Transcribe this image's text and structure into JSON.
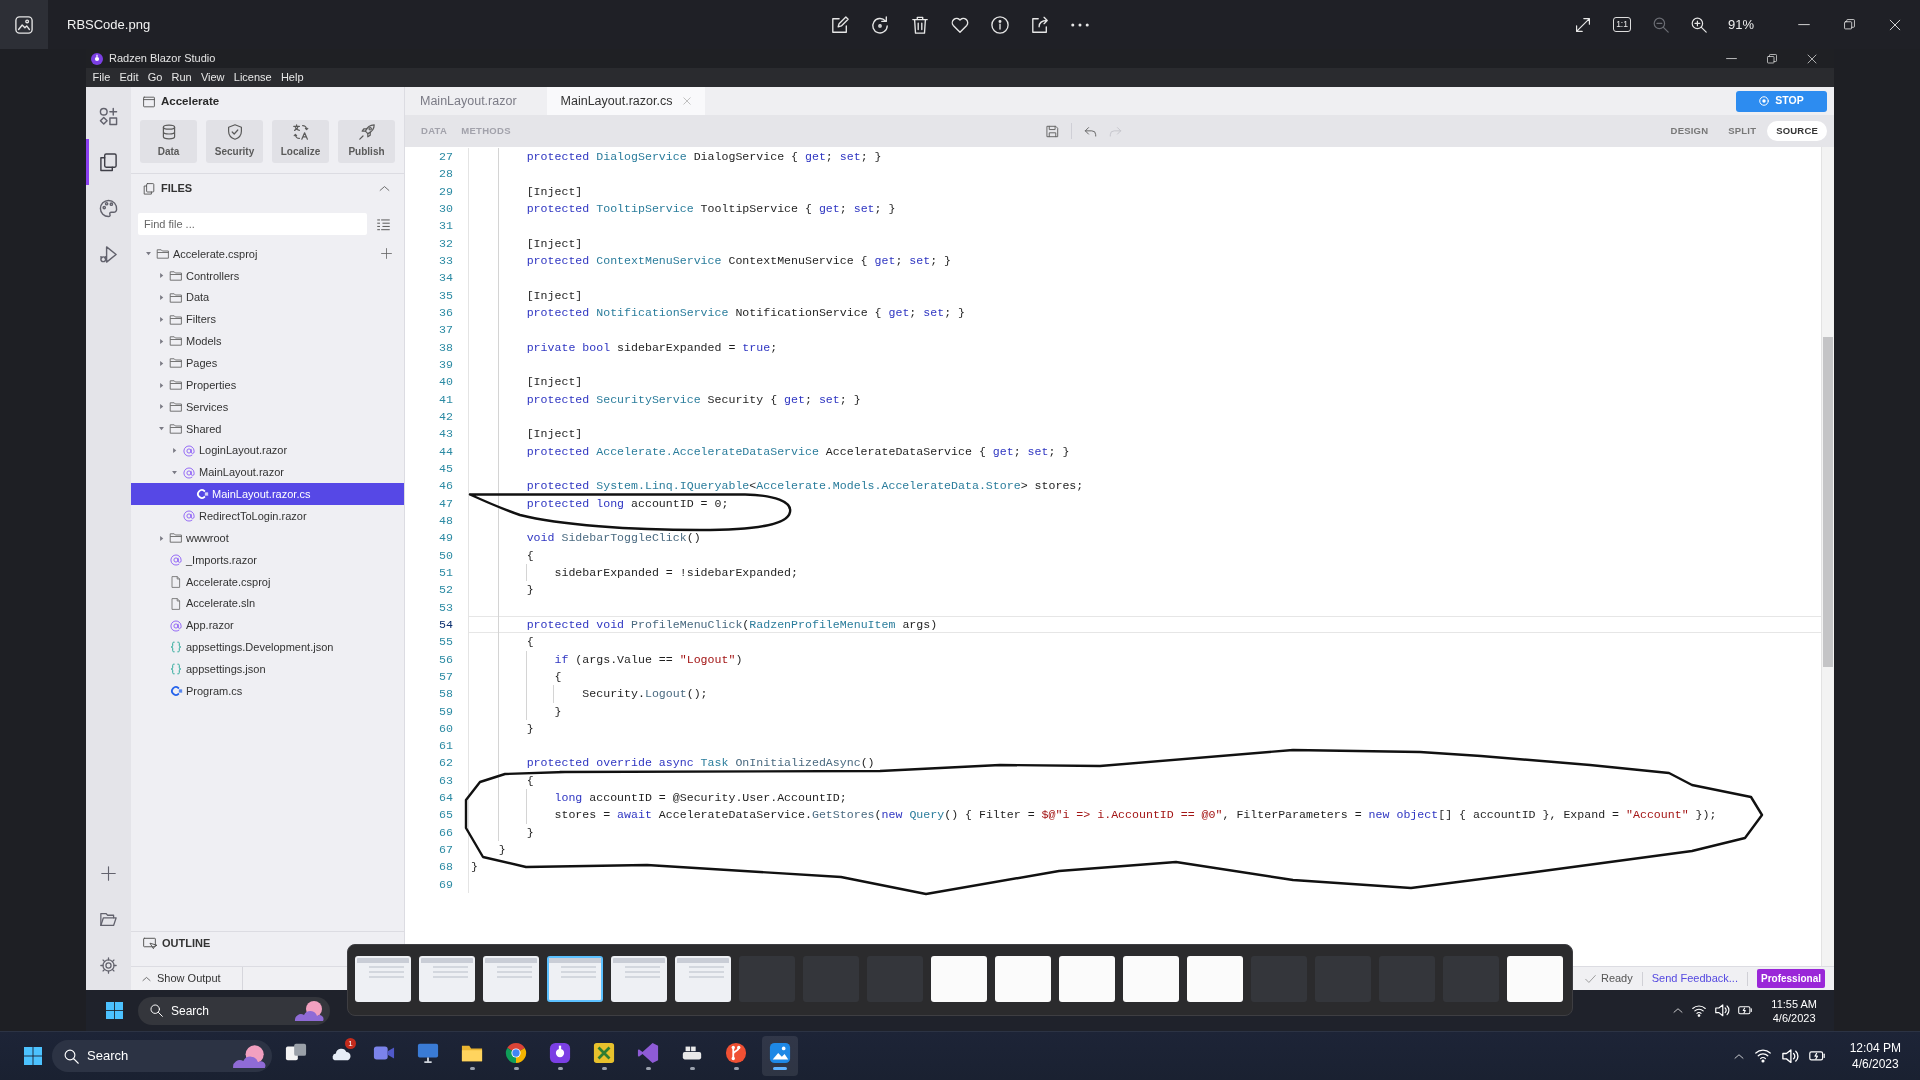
{
  "viewer": {
    "file_name": "RBSCode.png",
    "actual_size_label": "1:1",
    "can_zoom_out": false,
    "zoom_label": "91%"
  },
  "app": {
    "title": "Radzen Blazor Studio",
    "menu": [
      "File",
      "Edit",
      "Go",
      "Run",
      "View",
      "License",
      "Help"
    ]
  },
  "activity_bar": [
    {
      "kind": "components",
      "selected": false
    },
    {
      "kind": "files",
      "selected": true
    },
    {
      "kind": "themes",
      "selected": false
    },
    {
      "kind": "run",
      "selected": false
    }
  ],
  "project": {
    "name": "Accelerate",
    "tools": [
      {
        "kind": "data",
        "label": "Data"
      },
      {
        "kind": "security",
        "label": "Security"
      },
      {
        "kind": "localize",
        "label": "Localize"
      },
      {
        "kind": "publish",
        "label": "Publish"
      }
    ]
  },
  "files": {
    "title": "FILES",
    "search": {
      "placeholder": "Find file ..."
    },
    "tree": [
      {
        "label": "Accelerate.csproj",
        "kind": "folder",
        "expanded": true,
        "selected": false,
        "children": [
          {
            "label": "Controllers",
            "kind": "folder",
            "expanded": false,
            "selected": false
          },
          {
            "label": "Data",
            "kind": "folder",
            "expanded": false,
            "selected": false
          },
          {
            "label": "Filters",
            "kind": "folder",
            "expanded": false,
            "selected": false
          },
          {
            "label": "Models",
            "kind": "folder",
            "expanded": false,
            "selected": false
          },
          {
            "label": "Pages",
            "kind": "folder",
            "expanded": false,
            "selected": false
          },
          {
            "label": "Properties",
            "kind": "folder",
            "expanded": false,
            "selected": false
          },
          {
            "label": "Services",
            "kind": "folder",
            "expanded": false,
            "selected": false
          },
          {
            "label": "Shared",
            "kind": "folder",
            "expanded": true,
            "selected": false,
            "children": [
              {
                "label": "LoginLayout.razor",
                "kind": "razor",
                "expanded": false,
                "selected": false
              },
              {
                "label": "MainLayout.razor",
                "kind": "razor",
                "expanded": true,
                "selected": false,
                "children": [
                  {
                    "label": "MainLayout.razor.cs",
                    "kind": "csharp",
                    "selected": true
                  }
                ]
              },
              {
                "label": "RedirectToLogin.razor",
                "kind": "razor",
                "selected": false
              }
            ]
          },
          {
            "label": "wwwroot",
            "kind": "folder",
            "expanded": false,
            "selected": false
          },
          {
            "label": "_Imports.razor",
            "kind": "razor",
            "selected": false
          },
          {
            "label": "Accelerate.csproj",
            "kind": "file",
            "selected": false
          },
          {
            "label": "Accelerate.sln",
            "kind": "file",
            "selected": false
          },
          {
            "label": "App.razor",
            "kind": "razor",
            "selected": false
          },
          {
            "label": "appsettings.Development.json",
            "kind": "json",
            "selected": false
          },
          {
            "label": "appsettings.json",
            "kind": "json",
            "selected": false
          },
          {
            "label": "Program.cs",
            "kind": "csharp",
            "selected": false
          }
        ]
      }
    ]
  },
  "outline": {
    "title": "OUTLINE"
  },
  "tabs": [
    {
      "label": "MainLayout.razor",
      "selected": false
    },
    {
      "label": "MainLayout.razor.cs",
      "selected": true
    }
  ],
  "run_button": "STOP",
  "designer_tabs": [
    "DATA",
    "METHODS"
  ],
  "history": {
    "can_undo": true,
    "can_redo": false
  },
  "view_modes": [
    {
      "label": "DESIGN",
      "selected": false
    },
    {
      "label": "SPLIT",
      "selected": false
    },
    {
      "label": "SOURCE",
      "selected": true
    }
  ],
  "editor": {
    "lines": [
      {
        "number": "27",
        "current": false,
        "tokens": [
          {
            "kind": "keyword",
            "text": "protected "
          },
          {
            "kind": "type",
            "text": "DialogService"
          },
          {
            "kind": "text",
            "text": " DialogService { "
          },
          {
            "kind": "keyword",
            "text": "get"
          },
          {
            "kind": "text",
            "text": "; "
          },
          {
            "kind": "keyword",
            "text": "set"
          },
          {
            "kind": "text",
            "text": "; }"
          }
        ]
      },
      {
        "number": "28",
        "current": false
      },
      {
        "number": "29",
        "current": false,
        "tokens": [
          {
            "kind": "text",
            "text": "[Inject]"
          }
        ]
      },
      {
        "number": "30",
        "current": false,
        "tokens": [
          {
            "kind": "keyword",
            "text": "protected "
          },
          {
            "kind": "type",
            "text": "TooltipService"
          },
          {
            "kind": "text",
            "text": " TooltipService { "
          },
          {
            "kind": "keyword",
            "text": "get"
          },
          {
            "kind": "text",
            "text": "; "
          },
          {
            "kind": "keyword",
            "text": "set"
          },
          {
            "kind": "text",
            "text": "; }"
          }
        ]
      },
      {
        "number": "31",
        "current": false
      },
      {
        "number": "32",
        "current": false,
        "tokens": [
          {
            "kind": "text",
            "text": "[Inject]"
          }
        ]
      },
      {
        "number": "33",
        "current": false,
        "tokens": [
          {
            "kind": "keyword",
            "text": "protected "
          },
          {
            "kind": "type",
            "text": "ContextMenuService"
          },
          {
            "kind": "text",
            "text": " ContextMenuService { "
          },
          {
            "kind": "keyword",
            "text": "get"
          },
          {
            "kind": "text",
            "text": "; "
          },
          {
            "kind": "keyword",
            "text": "set"
          },
          {
            "kind": "text",
            "text": "; }"
          }
        ]
      },
      {
        "number": "34",
        "current": false
      },
      {
        "number": "35",
        "current": false,
        "tokens": [
          {
            "kind": "text",
            "text": "[Inject]"
          }
        ]
      },
      {
        "number": "36",
        "current": false,
        "tokens": [
          {
            "kind": "keyword",
            "text": "protected "
          },
          {
            "kind": "type",
            "text": "NotificationService"
          },
          {
            "kind": "text",
            "text": " NotificationService { "
          },
          {
            "kind": "keyword",
            "text": "get"
          },
          {
            "kind": "text",
            "text": "; "
          },
          {
            "kind": "keyword",
            "text": "set"
          },
          {
            "kind": "text",
            "text": "; }"
          }
        ]
      },
      {
        "number": "37",
        "current": false
      },
      {
        "number": "38",
        "current": false,
        "tokens": [
          {
            "kind": "keyword",
            "text": "private bool"
          },
          {
            "kind": "text",
            "text": " sidebarExpanded = "
          },
          {
            "kind": "keyword",
            "text": "true"
          },
          {
            "kind": "text",
            "text": ";"
          }
        ]
      },
      {
        "number": "39",
        "current": false
      },
      {
        "number": "40",
        "current": false,
        "tokens": [
          {
            "kind": "text",
            "text": "[Inject]"
          }
        ]
      },
      {
        "number": "41",
        "current": false,
        "tokens": [
          {
            "kind": "keyword",
            "text": "protected "
          },
          {
            "kind": "type",
            "text": "SecurityService"
          },
          {
            "kind": "text",
            "text": " Security { "
          },
          {
            "kind": "keyword",
            "text": "get"
          },
          {
            "kind": "text",
            "text": "; "
          },
          {
            "kind": "keyword",
            "text": "set"
          },
          {
            "kind": "text",
            "text": "; }"
          }
        ]
      },
      {
        "number": "42",
        "current": false
      },
      {
        "number": "43",
        "current": false,
        "tokens": [
          {
            "kind": "text",
            "text": "[Inject]"
          }
        ]
      },
      {
        "number": "44",
        "current": false,
        "tokens": [
          {
            "kind": "keyword",
            "text": "protected "
          },
          {
            "kind": "type",
            "text": "Accelerate.AccelerateDataService"
          },
          {
            "kind": "text",
            "text": " AccelerateDataService { "
          },
          {
            "kind": "keyword",
            "text": "get"
          },
          {
            "kind": "text",
            "text": "; "
          },
          {
            "kind": "keyword",
            "text": "set"
          },
          {
            "kind": "text",
            "text": "; }"
          }
        ]
      },
      {
        "number": "45",
        "current": false
      },
      {
        "number": "46",
        "current": false,
        "tokens": [
          {
            "kind": "keyword",
            "text": "protected "
          },
          {
            "kind": "type",
            "text": "System.Linq.IQueryable"
          },
          {
            "kind": "text",
            "text": "<"
          },
          {
            "kind": "type",
            "text": "Accelerate.Models.AccelerateData.Store"
          },
          {
            "kind": "text",
            "text": "> stores;"
          }
        ]
      },
      {
        "number": "47",
        "current": false,
        "tokens": [
          {
            "kind": "keyword",
            "text": "protected long"
          },
          {
            "kind": "text",
            "text": " accountID = 0;"
          }
        ]
      },
      {
        "number": "48",
        "current": false
      },
      {
        "number": "49",
        "current": false,
        "tokens": [
          {
            "kind": "keyword",
            "text": "void "
          },
          {
            "kind": "method",
            "text": "SidebarToggleClick"
          },
          {
            "kind": "text",
            "text": "()"
          }
        ]
      },
      {
        "number": "50",
        "current": false,
        "tokens": [
          {
            "kind": "text",
            "text": "{"
          }
        ]
      },
      {
        "number": "51",
        "current": false,
        "tokens": [
          {
            "kind": "text",
            "text": "sidebarExpanded = !sidebarExpanded;"
          }
        ]
      },
      {
        "number": "52",
        "current": false,
        "tokens": [
          {
            "kind": "text",
            "text": "}"
          }
        ]
      },
      {
        "number": "53",
        "current": false
      },
      {
        "number": "54",
        "current": true,
        "tokens": [
          {
            "kind": "keyword",
            "text": "protected void "
          },
          {
            "kind": "method",
            "text": "ProfileMenuClick"
          },
          {
            "kind": "text",
            "text": "("
          },
          {
            "kind": "type",
            "text": "RadzenProfileMenuItem"
          },
          {
            "kind": "text",
            "text": " args)"
          }
        ]
      },
      {
        "number": "55",
        "current": false,
        "tokens": [
          {
            "kind": "text",
            "text": "{"
          }
        ]
      },
      {
        "number": "56",
        "current": false,
        "tokens": [
          {
            "kind": "keyword",
            "text": "if"
          },
          {
            "kind": "text",
            "text": " (args.Value == "
          },
          {
            "kind": "string",
            "text": "\"Logout\""
          },
          {
            "kind": "text",
            "text": ")"
          }
        ]
      },
      {
        "number": "57",
        "current": false,
        "tokens": [
          {
            "kind": "text",
            "text": "{"
          }
        ]
      },
      {
        "number": "58",
        "current": false,
        "tokens": [
          {
            "kind": "text",
            "text": "Security."
          },
          {
            "kind": "method",
            "text": "Logout"
          },
          {
            "kind": "text",
            "text": "();"
          }
        ]
      },
      {
        "number": "59",
        "current": false,
        "tokens": [
          {
            "kind": "text",
            "text": "}"
          }
        ]
      },
      {
        "number": "60",
        "current": false,
        "tokens": [
          {
            "kind": "text",
            "text": "}"
          }
        ]
      },
      {
        "number": "61",
        "current": false
      },
      {
        "number": "62",
        "current": false,
        "tokens": [
          {
            "kind": "keyword",
            "text": "protected override async "
          },
          {
            "kind": "type",
            "text": "Task"
          },
          {
            "kind": "method",
            "text": " OnInitializedAsync"
          },
          {
            "kind": "text",
            "text": "()"
          }
        ]
      },
      {
        "number": "63",
        "current": false,
        "tokens": [
          {
            "kind": "text",
            "text": "{"
          }
        ]
      },
      {
        "number": "64",
        "current": false,
        "tokens": [
          {
            "kind": "keyword",
            "text": "long"
          },
          {
            "kind": "text",
            "text": " accountID = @Security.User.AccountID;"
          }
        ]
      },
      {
        "number": "65",
        "current": false,
        "tokens": [
          {
            "kind": "text",
            "text": "stores = "
          },
          {
            "kind": "keyword",
            "text": "await"
          },
          {
            "kind": "text",
            "text": " AccelerateDataService."
          },
          {
            "kind": "method",
            "text": "GetStores"
          },
          {
            "kind": "text",
            "text": "("
          },
          {
            "kind": "keyword",
            "text": "new "
          },
          {
            "kind": "type",
            "text": "Query"
          },
          {
            "kind": "text",
            "text": "() { Filter = "
          },
          {
            "kind": "string",
            "text": "$@\"i => i.AccountID == @0\""
          },
          {
            "kind": "text",
            "text": ", FilterParameters = "
          },
          {
            "kind": "keyword",
            "text": "new object"
          },
          {
            "kind": "text",
            "text": "[] { accountID }, Expand = "
          },
          {
            "kind": "string",
            "text": "\"Account\""
          },
          {
            "kind": "text",
            "text": " });"
          }
        ]
      },
      {
        "number": "66",
        "current": false,
        "tokens": [
          {
            "kind": "text",
            "text": "}"
          }
        ]
      },
      {
        "number": "67",
        "current": false,
        "tokens": [
          {
            "kind": "text",
            "text": "}"
          }
        ]
      },
      {
        "number": "68",
        "current": false,
        "tokens": [
          {
            "kind": "text",
            "text": "}"
          }
        ]
      },
      {
        "number": "69",
        "current": false
      }
    ]
  },
  "status_bar": {
    "output_toggle": "Show Output",
    "state": "Ready",
    "feedback_link": "Send Feedback...",
    "edition": "Professional"
  },
  "filmstrip": [
    {
      "kind": "screen",
      "selected": false
    },
    {
      "kind": "screen",
      "selected": false
    },
    {
      "kind": "screen",
      "selected": false
    },
    {
      "kind": "screen",
      "selected": true
    },
    {
      "kind": "screen",
      "selected": false
    },
    {
      "kind": "screen",
      "selected": false
    },
    {
      "kind": "dark",
      "selected": false
    },
    {
      "kind": "dark",
      "selected": false
    },
    {
      "kind": "dark",
      "selected": false
    },
    {
      "kind": "light",
      "selected": false
    },
    {
      "kind": "light",
      "selected": false
    },
    {
      "kind": "light",
      "selected": false
    },
    {
      "kind": "light",
      "selected": false
    },
    {
      "kind": "light",
      "selected": false
    },
    {
      "kind": "dark",
      "selected": false
    },
    {
      "kind": "dark",
      "selected": false
    },
    {
      "kind": "dark",
      "selected": false
    },
    {
      "kind": "dark",
      "selected": false
    },
    {
      "kind": "light",
      "selected": false
    }
  ],
  "screenshot_taskbar": {
    "search_label": "Search",
    "time": "11:55 AM",
    "date": "4/6/2023"
  },
  "taskbar": {
    "search_label": "Search",
    "apps": [
      {
        "kind": "task-view",
        "running": false,
        "selected": false
      },
      {
        "kind": "weather",
        "badge": "1",
        "running": false,
        "selected": false
      },
      {
        "kind": "video",
        "running": false,
        "selected": false
      },
      {
        "kind": "monitor",
        "running": false,
        "selected": false
      },
      {
        "kind": "folder",
        "running": true,
        "selected": false
      },
      {
        "kind": "browser",
        "running": true,
        "selected": false
      },
      {
        "kind": "studio",
        "running": true,
        "selected": false
      },
      {
        "kind": "tool",
        "running": true,
        "selected": false
      },
      {
        "kind": "ide",
        "running": true,
        "selected": false
      },
      {
        "kind": "containers",
        "running": true,
        "selected": false
      },
      {
        "kind": "git",
        "running": true,
        "selected": false
      },
      {
        "kind": "photos",
        "running": true,
        "selected": true
      }
    ],
    "time": "12:04 PM",
    "date": "4/6/2023"
  }
}
